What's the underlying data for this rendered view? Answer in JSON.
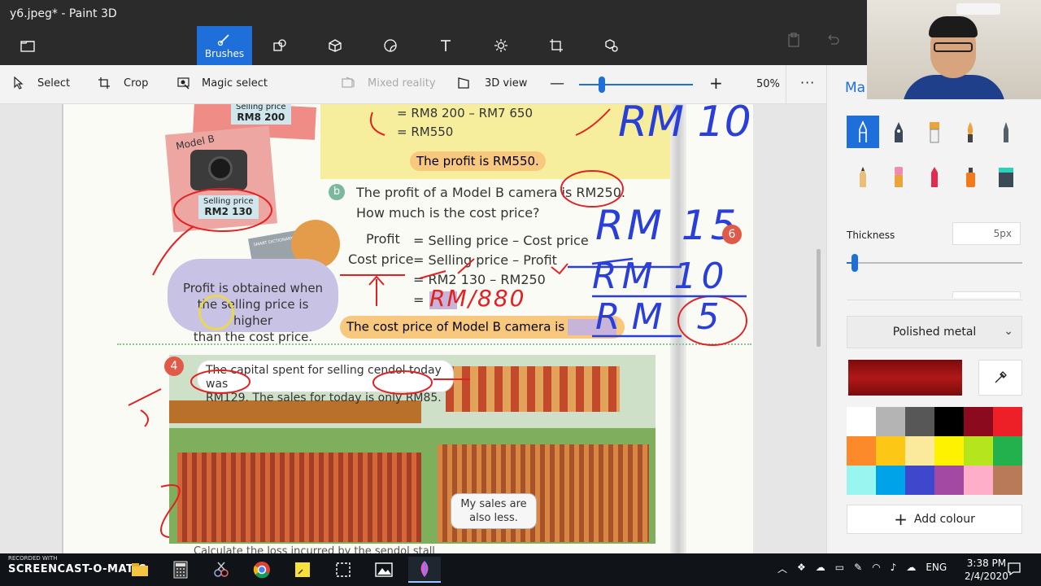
{
  "window": {
    "title": "y6.jpeg* - Paint 3D"
  },
  "toolbar": {
    "tools": [
      {
        "name": "brushes",
        "label": "Brushes",
        "icon": "brush-icon",
        "active": true
      },
      {
        "name": "2d-shapes",
        "label": "",
        "icon": "shapes-2d-icon"
      },
      {
        "name": "3d-shapes",
        "label": "",
        "icon": "cube-icon"
      },
      {
        "name": "stickers",
        "label": "",
        "icon": "sticker-icon"
      },
      {
        "name": "text",
        "label": "",
        "icon": "text-icon"
      },
      {
        "name": "effects",
        "label": "",
        "icon": "sun-icon"
      },
      {
        "name": "canvas",
        "label": "",
        "icon": "canvas-crop-icon"
      },
      {
        "name": "3d-library",
        "label": "",
        "icon": "3d-library-icon"
      }
    ]
  },
  "commandbar": {
    "select": "Select",
    "crop": "Crop",
    "magic_select": "Magic select",
    "mixed_reality": "Mixed reality",
    "view_3d": "3D view",
    "zoom": "50%",
    "more": "···",
    "zoom_fraction": 0.2
  },
  "canvas": {
    "yellow_lines": [
      "= RM8 200 – RM7 650",
      "= RM550"
    ],
    "profit_a": "The profit is RM550.",
    "b_label": "b",
    "question_b1": "The profit of a Model B camera is RM250.",
    "question_b2": "How much is the cost price?",
    "eq_profit": "Profit",
    "eq_cost": "Cost price",
    "eq1": "= Selling price – Cost price",
    "eq2": "= Selling price – Profit",
    "eq3": "= RM2 130 – RM250",
    "eq4": "=",
    "cost_answer": "The cost price of Model B camera is",
    "bubble_line1": "Profit is obtained when",
    "bubble_line2": "the selling price is higher",
    "bubble_line3": "than the cost price.",
    "model_b": "Model B",
    "sp_label": "Selling price",
    "sp_value": "RM2 130",
    "sp_top_label": "Selling price",
    "sp_top_value": "RM8 200",
    "num4": "4",
    "speech_line1": "The capital spent for selling cendol today was",
    "speech_line2": "RM129. The sales for today is only RM85.",
    "sales_bubble": "My sales are also less.",
    "laptop_label": "SMART DICTIONARY",
    "ink_rm10_top": "RM 10",
    "ink_rm15": "RM 15",
    "ink_rm10": "RM 10",
    "ink_rm5": "RM 5",
    "ink_rm1880": "RM/880",
    "ink_6_badge": "6",
    "bottom_text": "Calculate the loss incurred by the sendol stall"
  },
  "panel": {
    "title": "Ma",
    "brushes": [
      {
        "icon": "marker-icon",
        "selected": true
      },
      {
        "icon": "calligraphy-pen-icon"
      },
      {
        "icon": "oil-brush-icon"
      },
      {
        "icon": "watercolor-icon"
      },
      {
        "icon": "pixel-pen-icon"
      },
      {
        "icon": "pencil-icon"
      },
      {
        "icon": "eraser-icon"
      },
      {
        "icon": "crayon-icon"
      },
      {
        "icon": "spray-can-icon"
      },
      {
        "icon": "fill-bucket-icon"
      }
    ],
    "thickness_label": "Thickness",
    "thickness_value": "5px",
    "thickness_fraction": 0.03,
    "material": "Polished metal",
    "current_color": "#b01818",
    "palette": [
      "#ffffff",
      "#b4b4b4",
      "#575757",
      "#000000",
      "#8b0a1e",
      "#ee2027",
      "#fc8a2a",
      "#fdc715",
      "#fcea9c",
      "#fff200",
      "#b5e61d",
      "#22b14c",
      "#99f5f0",
      "#00a2e8",
      "#3f48cc",
      "#a349a4",
      "#ffaec9",
      "#b97a57"
    ],
    "add_colour": "Add colour"
  },
  "taskbar": {
    "recorded_with": "RECORDED WITH",
    "screencast": "SCREENCAST-O-MATIC",
    "apps": [
      {
        "icon": "file-explorer-icon"
      },
      {
        "icon": "calculator-icon"
      },
      {
        "icon": "snipping-icon"
      },
      {
        "icon": "chrome-icon"
      },
      {
        "icon": "sticky-notes-icon"
      },
      {
        "icon": "screen-select-icon"
      },
      {
        "icon": "photos-icon"
      },
      {
        "icon": "paint3d-icon",
        "active": true
      }
    ],
    "lang": "ENG",
    "time": "3:38 PM",
    "date": "2/4/2020"
  }
}
